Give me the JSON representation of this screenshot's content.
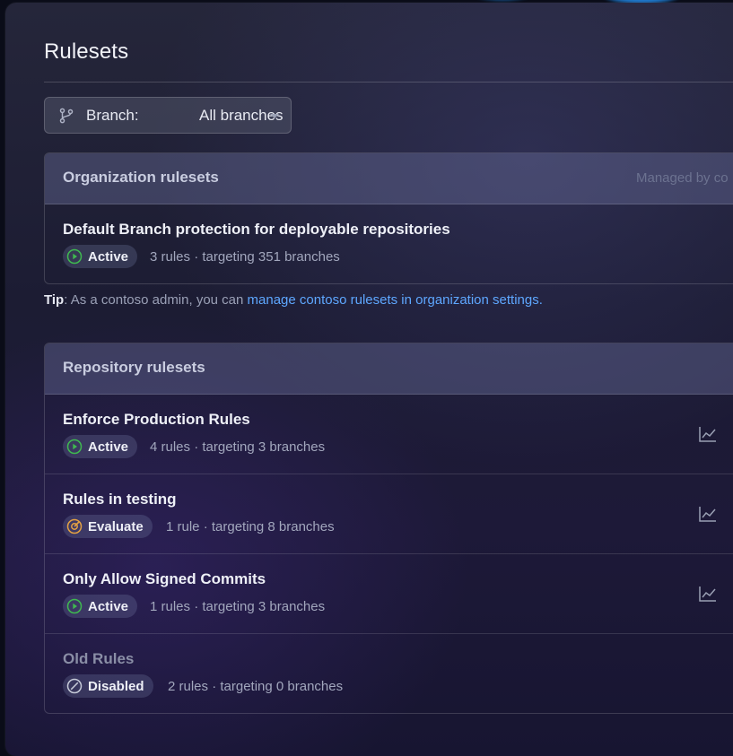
{
  "page": {
    "title": "Rulesets"
  },
  "branch_filter": {
    "label": "Branch:",
    "value": "All branches"
  },
  "org_rulesets": {
    "header": "Organization rulesets",
    "managed_by": "Managed by co",
    "items": [
      {
        "name": "Default Branch protection for deployable repositories",
        "status": "Active",
        "meta": "3 rules · targeting 351 branches"
      }
    ]
  },
  "tip": {
    "label": "Tip",
    "text": ": As a contoso admin, you can ",
    "link": "manage contoso rulesets in organization settings."
  },
  "repo_rulesets": {
    "header": "Repository rulesets",
    "items": [
      {
        "name": "Enforce Production Rules",
        "status": "Active",
        "meta": "4 rules · targeting 3 branches"
      },
      {
        "name": "Rules in testing",
        "status": "Evaluate",
        "meta": "1 rule · targeting 8 branches"
      },
      {
        "name": "Only Allow Signed Commits",
        "status": "Active",
        "meta": "1 rules · targeting 3 branches"
      },
      {
        "name": "Old Rules",
        "status": "Disabled",
        "meta": "2 rules · targeting 0 branches"
      }
    ]
  },
  "colors": {
    "active": "#3fb950",
    "evaluate": "#e3a143",
    "disabled": "#9aa0b4",
    "link": "#5ea7ff"
  },
  "icons": {
    "branch": "git-branch-icon",
    "active": "play-circle-icon",
    "evaluate": "target-icon",
    "disabled": "slash-circle-icon",
    "insights": "graph-icon"
  }
}
